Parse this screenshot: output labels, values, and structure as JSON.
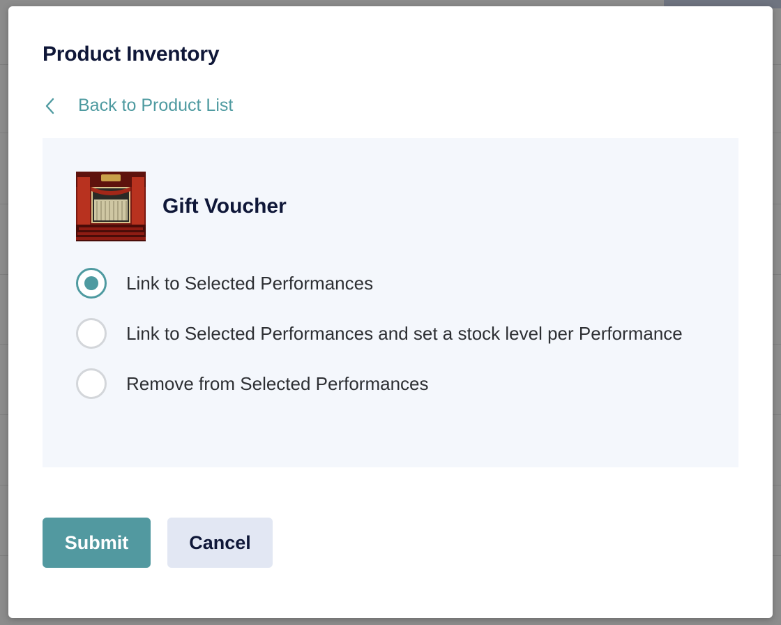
{
  "modal": {
    "title": "Product Inventory",
    "back_link": "Back to Product List"
  },
  "product": {
    "name": "Gift Voucher",
    "thumbnail": "theatre-stage-image"
  },
  "options": [
    {
      "label": "Link to Selected Performances",
      "selected": true
    },
    {
      "label": "Link to Selected Performances and set a stock level per Performance",
      "selected": false
    },
    {
      "label": "Remove from Selected Performances",
      "selected": false
    }
  ],
  "actions": {
    "submit_label": "Submit",
    "cancel_label": "Cancel"
  },
  "colors": {
    "accent": "#4e9aa0",
    "title": "#0f1738",
    "panel_bg": "#f4f7fc",
    "cancel_bg": "#e2e7f3"
  }
}
